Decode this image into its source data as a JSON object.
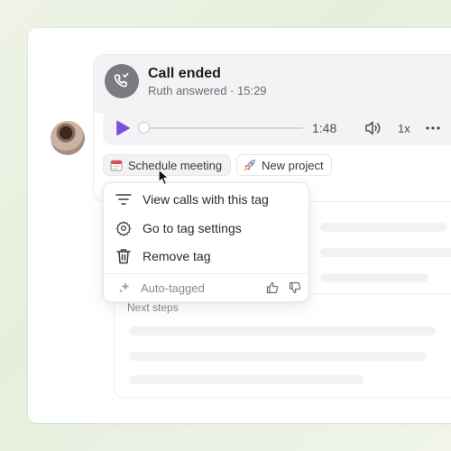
{
  "call": {
    "title": "Call ended",
    "subtitle": "Ruth answered · 15:29",
    "duration": "1:48",
    "speed": "1x",
    "progress": 0.0
  },
  "tags": [
    {
      "label": "Schedule meeting",
      "icon": "calendar-icon"
    },
    {
      "label": "New project",
      "icon": "rocket-icon"
    }
  ],
  "menu": {
    "items": [
      {
        "label": "View calls with this tag",
        "icon": "filter-icon"
      },
      {
        "label": "Go to tag settings",
        "icon": "gear-icon"
      },
      {
        "label": "Remove tag",
        "icon": "trash-icon"
      }
    ],
    "auto_label": "Auto-tagged"
  },
  "notes": {
    "next_steps_label": "Next steps"
  },
  "colors": {
    "accent": "#7b4ce0",
    "phone_circle": "#7a7a80"
  }
}
